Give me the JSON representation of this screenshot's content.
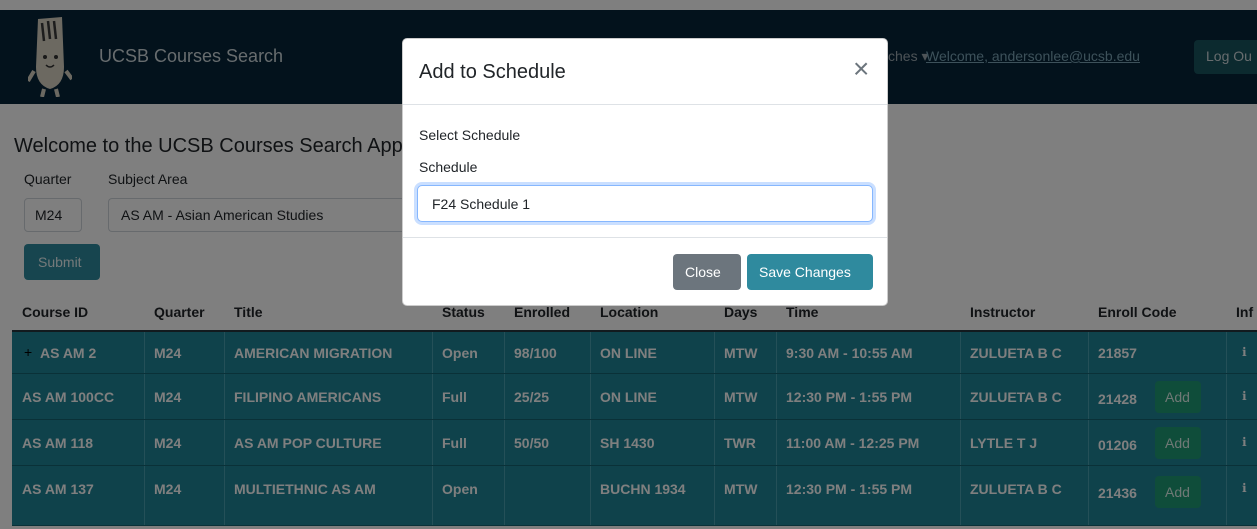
{
  "navbar": {
    "brand": "UCSB Courses Search",
    "menu_partial": "ches ▾",
    "welcome": "Welcome, andersonlee@ucsb.edu",
    "logout_label": "Log Ou"
  },
  "page": {
    "welcome_heading": "Welcome to the UCSB Courses Search App!",
    "quarter_label": "Quarter",
    "subject_label": "Subject Area",
    "quarter_value": "M24",
    "subject_value": "AS AM - Asian American Studies",
    "submit_label": "Submit"
  },
  "table": {
    "headers": [
      "Course ID",
      "Quarter",
      "Title",
      "Status",
      "Enrolled",
      "Location",
      "Days",
      "Time",
      "Instructor",
      "Enroll Code",
      "Inf"
    ],
    "rows": [
      {
        "course_id": "AS AM 2",
        "quarter": "M24",
        "title": "AMERICAN MIGRATION",
        "status": "Open",
        "enrolled": "98/100",
        "location": "ON LINE",
        "days": "MTW",
        "time": "9:30 AM - 10:55 AM",
        "instructor": "ZULUETA B C",
        "enroll_code": "21857",
        "add": ""
      },
      {
        "course_id": "AS AM 100CC",
        "quarter": "M24",
        "title": "FILIPINO AMERICANS",
        "status": "Full",
        "enrolled": "25/25",
        "location": "ON LINE",
        "days": "MTW",
        "time": "12:30 PM - 1:55 PM",
        "instructor": "ZULUETA B C",
        "enroll_code": "21428",
        "add": "Add"
      },
      {
        "course_id": "AS AM 118",
        "quarter": "M24",
        "title": "AS AM POP CULTURE",
        "status": "Full",
        "enrolled": "50/50",
        "location": "SH 1430",
        "days": "TWR",
        "time": "11:00 AM - 12:25 PM",
        "instructor": "LYTLE T J",
        "enroll_code": "01206",
        "add": "Add"
      },
      {
        "course_id": "AS AM 137",
        "quarter": "M24",
        "title": "MULTIETHNIC AS AM",
        "status": "Open",
        "enrolled": "",
        "location": "BUCHN 1934",
        "days": "MTW",
        "time": "12:30 PM - 1:55 PM",
        "instructor": "ZULUETA B C",
        "enroll_code": "21436",
        "add": "Add"
      }
    ]
  },
  "modal": {
    "title": "Add to Schedule",
    "close_glyph": "×",
    "select_label": "Select Schedule",
    "schedule_label": "Schedule",
    "schedule_value": "F24 Schedule 1",
    "close_label": "Close",
    "save_label": "Save Changes"
  },
  "icons": {
    "plus": "+",
    "info": "ℹ"
  },
  "colors": {
    "navbar": "#062539",
    "row": "#1f8496",
    "primary": "#2f8a9e",
    "add": "#1f9a74",
    "secondary": "#6c757d"
  }
}
